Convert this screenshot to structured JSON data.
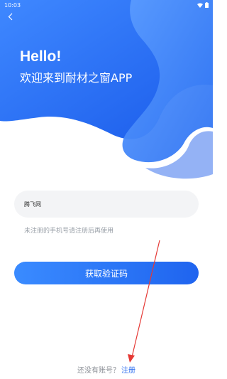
{
  "status_bar": {
    "time": "10:03"
  },
  "header": {
    "greeting": "Hello!",
    "welcome": "欢迎来到耐材之窗APP"
  },
  "form": {
    "phone_value": "腾飞网",
    "hint": "未注册的手机号请注册后再使用",
    "get_code_label": "获取验证码"
  },
  "footer": {
    "no_account": "还没有账号？",
    "register_link": "注册"
  },
  "colors": {
    "primary": "#2d6ef0",
    "annotation_arrow": "#e53935"
  },
  "icons": [
    "back-arrow-icon",
    "wifi-icon",
    "battery-icon"
  ]
}
